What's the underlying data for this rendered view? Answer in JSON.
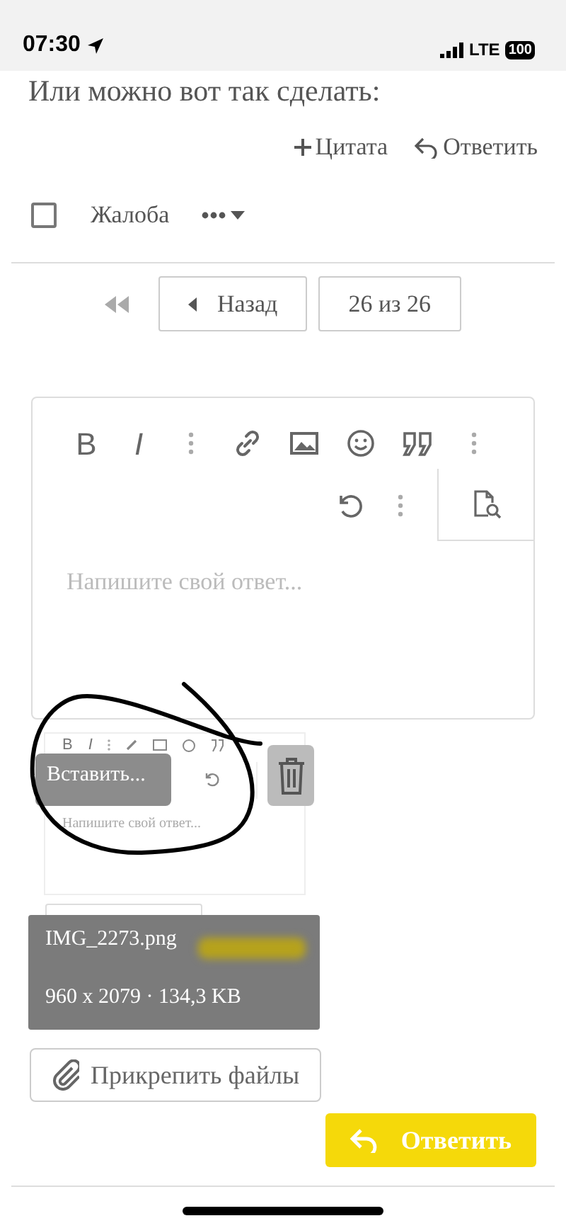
{
  "status_bar": {
    "time": "07:30",
    "network": "LTE",
    "battery": "100"
  },
  "post": {
    "text": "Или можно вот так сделать:",
    "actions": [
      {
        "kind": "quote",
        "label": "Цитата"
      },
      {
        "kind": "reply",
        "label": "Ответить"
      }
    ]
  },
  "moderation": {
    "checked": false,
    "report_label": "Жалоба"
  },
  "pagination": {
    "back": "Назад",
    "position": "26 из 26"
  },
  "editor": {
    "format_buttons": [
      "B",
      "I"
    ],
    "placeholder": "Напишите свой ответ..."
  },
  "drag_preview": {
    "format_buttons": [
      "B",
      "I"
    ],
    "placeholder": "Напишите свой ответ...",
    "paste_menu": "Вставить...",
    "file_name": "IMG_2273.png",
    "file_info": "960 x 2079 · 134,3 KB"
  },
  "attach_button": "Прикрепить файлы",
  "submit_button": "Ответить"
}
